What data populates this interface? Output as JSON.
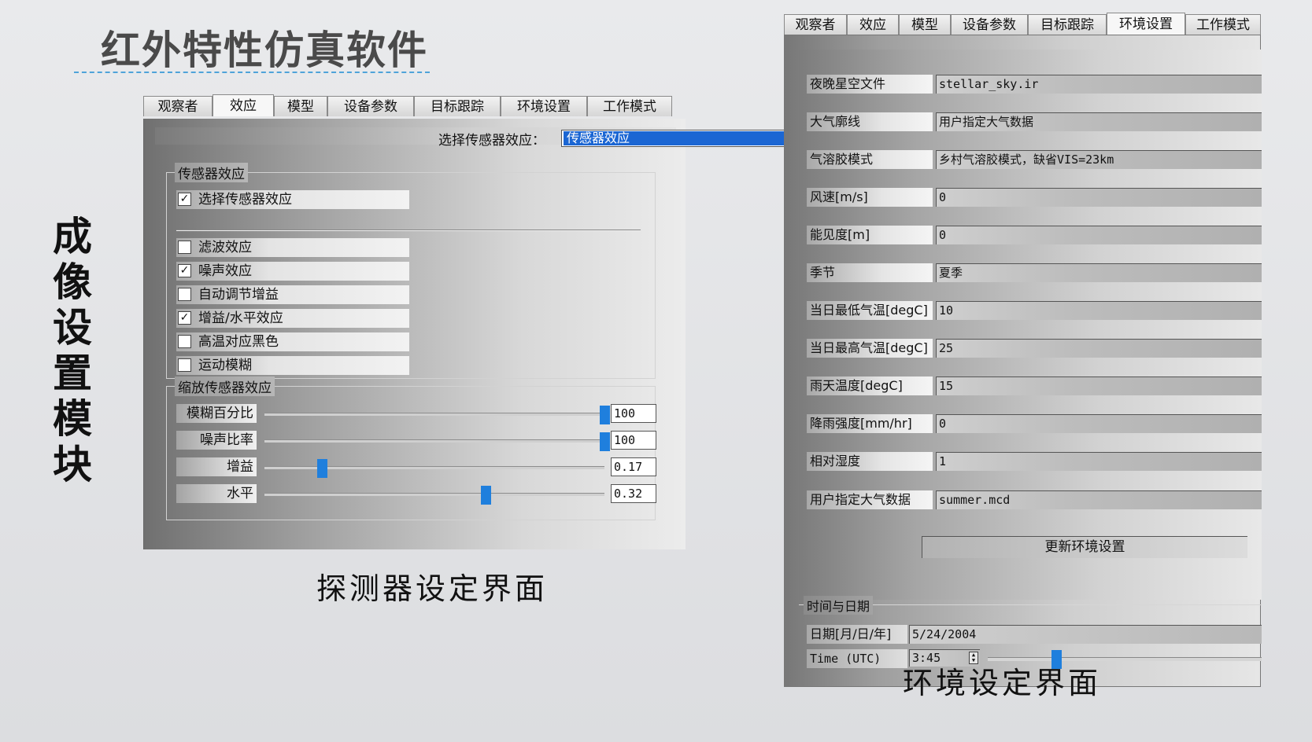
{
  "slide": {
    "title": "红外特性仿真软件",
    "side_title": [
      "成",
      "像",
      "设",
      "置",
      "模",
      "块"
    ],
    "caption_left": "探测器设定界面",
    "caption_right": "环境设定界面"
  },
  "tabs": [
    "观察者",
    "效应",
    "模型",
    "设备参数",
    "目标跟踪",
    "环境设置",
    "工作模式"
  ],
  "detector": {
    "active_tab": "效应",
    "sensor_select_label": "选择传感器效应：",
    "sensor_select_value": "传感器效应",
    "sensor_group_title": "传感器效应",
    "checkboxes": [
      {
        "label": "选择传感器效应",
        "checked": true
      },
      {
        "label": "滤波效应",
        "checked": false
      },
      {
        "label": "噪声效应",
        "checked": true
      },
      {
        "label": "自动调节增益",
        "checked": false
      },
      {
        "label": "增益/水平效应",
        "checked": true
      },
      {
        "label": "高温对应黑色",
        "checked": false
      },
      {
        "label": "运动模糊",
        "checked": false
      }
    ],
    "scale_group_title": "缩放传感器效应",
    "sliders": [
      {
        "label": "模糊百分比",
        "value": "100",
        "level": 1.0
      },
      {
        "label": "噪声比率",
        "value": "100",
        "level": 1.0
      },
      {
        "label": "增益",
        "value": "0.17",
        "level": 0.17
      },
      {
        "label": "水平",
        "value": "0.32",
        "level": 0.65
      }
    ]
  },
  "environment": {
    "active_tab": "环境设置",
    "rows": [
      {
        "label": "夜晚星空文件",
        "value": "stellar_sky.ir"
      },
      {
        "label": "大气廓线",
        "value": "用户指定大气数据"
      },
      {
        "label": "气溶胶模式",
        "value": "乡村气溶胶模式，缺省VIS=23km"
      },
      {
        "label": "风速[m/s]",
        "value": "0"
      },
      {
        "label": "能见度[m]",
        "value": "0"
      },
      {
        "label": "季节",
        "value": "夏季"
      },
      {
        "label": "当日最低气温[degC]",
        "value": "10"
      },
      {
        "label": "当日最高气温[degC]",
        "value": "25"
      },
      {
        "label": "雨天温度[degC]",
        "value": "15"
      },
      {
        "label": "降雨强度[mm/hr]",
        "value": "0"
      },
      {
        "label": "相对湿度",
        "value": "1"
      },
      {
        "label": "用户指定大气数据",
        "value": "summer.mcd"
      }
    ],
    "update_button": "更新环境设置",
    "time_group_title": "时间与日期",
    "date_label": "日期[月/日/年]",
    "date_value": "5/24/2004",
    "time_label": "Time (UTC)",
    "time_value": "3:45",
    "time_level": 0.25
  }
}
